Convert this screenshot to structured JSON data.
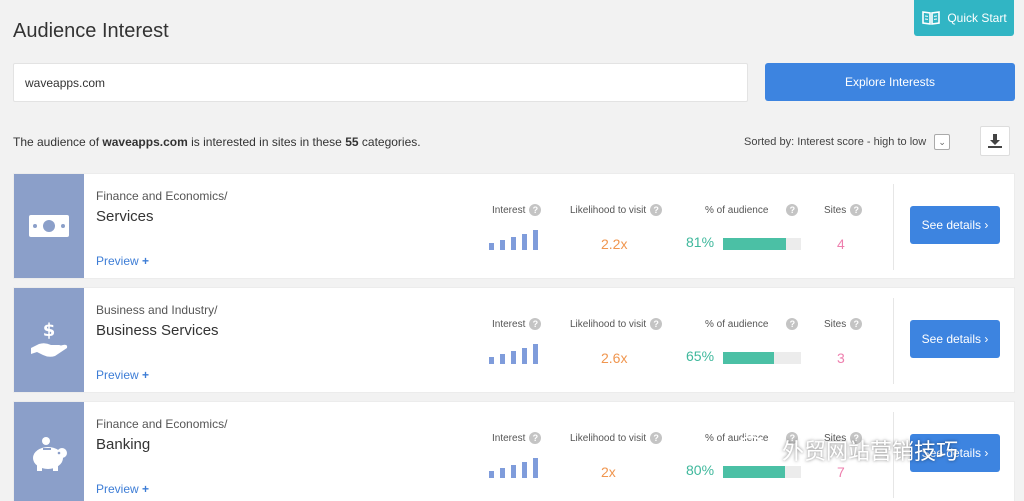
{
  "page": {
    "title": "Audience Interest"
  },
  "quick_start": {
    "label": "Quick Start",
    "icon": "book-icon"
  },
  "search": {
    "value": "waveapps.com",
    "button_label": "Explore Interests"
  },
  "summary": {
    "prefix": "The audience of ",
    "site": "waveapps.com",
    "middle": " is interested in sites in these ",
    "count": "55",
    "suffix": " categories."
  },
  "sort": {
    "label": "Sorted by: Interest score - high to low"
  },
  "metric_labels": {
    "interest": "Interest",
    "likelihood": "Likelihood to visit",
    "audience": "% of audience",
    "sites": "Sites"
  },
  "cards": [
    {
      "parent": "Finance and Economics/",
      "name": "Services",
      "preview": "Preview",
      "likelihood": "2.2x",
      "audience_pct": "81%",
      "audience_fraction": 0.81,
      "sites": "4",
      "details": "See details ›",
      "icon": "banknote-icon",
      "interest_level": 5
    },
    {
      "parent": "Business and Industry/",
      "name": "Business Services",
      "preview": "Preview",
      "likelihood": "2.6x",
      "audience_pct": "65%",
      "audience_fraction": 0.65,
      "sites": "3",
      "details": "See details ›",
      "icon": "hand-dollar-icon",
      "interest_level": 5
    },
    {
      "parent": "Finance and Economics/",
      "name": "Banking",
      "preview": "Preview",
      "likelihood": "2x",
      "audience_pct": "80%",
      "audience_fraction": 0.8,
      "sites": "7",
      "details": "See details ›",
      "icon": "piggy-bank-icon",
      "interest_level": 5
    }
  ],
  "watermark": {
    "text": "外贸网站营销技巧"
  },
  "colors": {
    "accent": "#3d84e0",
    "quick_start": "#31b5c4",
    "icon_panel": "#8b9fc9",
    "likelihood": "#f0964f",
    "audience": "#4bc0a5",
    "sites": "#ee7fae",
    "interest_bar": "#7f9cdb"
  }
}
